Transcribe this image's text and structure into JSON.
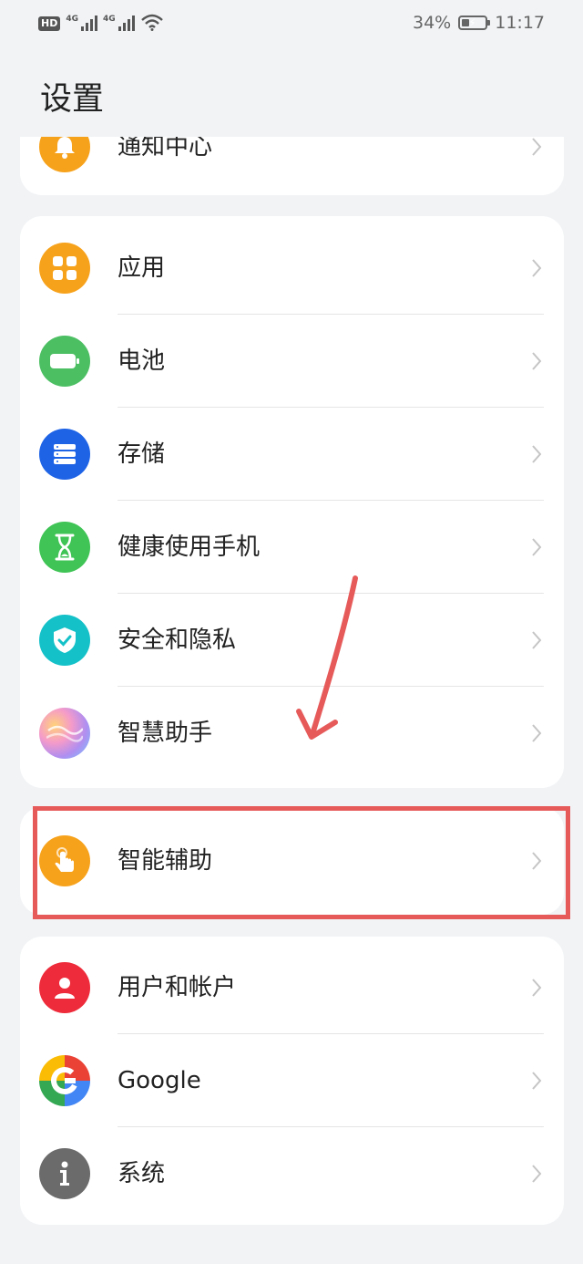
{
  "status_bar": {
    "hd_label": "HD",
    "sim1_label": "4G",
    "sim2_label": "4G",
    "battery_percent": "34%",
    "battery_level": 0.34,
    "time": "11:17"
  },
  "header": {
    "title": "设置"
  },
  "groups": [
    {
      "items": [
        {
          "label": "通知中心",
          "icon": "bell-icon",
          "color": "#f7a21b"
        }
      ]
    },
    {
      "items": [
        {
          "label": "应用",
          "icon": "apps-icon",
          "color": "#f7a21b"
        },
        {
          "label": "电池",
          "icon": "battery-icon",
          "color": "#4cbf63"
        },
        {
          "label": "存储",
          "icon": "storage-icon",
          "color": "#1e63e6"
        },
        {
          "label": "健康使用手机",
          "icon": "hourglass-icon",
          "color": "#3fc455"
        },
        {
          "label": "安全和隐私",
          "icon": "shield-icon",
          "color": "#14c1c8"
        },
        {
          "label": "智慧助手",
          "icon": "assistant-icon",
          "color": "#c9a2ea"
        }
      ]
    },
    {
      "items": [
        {
          "label": "智能辅助",
          "icon": "hand-touch-icon",
          "color": "#f7a21b"
        }
      ]
    },
    {
      "items": [
        {
          "label": "用户和帐户",
          "icon": "user-icon",
          "color": "#ee2b3a"
        },
        {
          "label": "Google",
          "icon": "google-icon",
          "color": "#4285f4"
        },
        {
          "label": "系统",
          "icon": "info-icon",
          "color": "#6b6b6b"
        }
      ]
    }
  ],
  "annotation": {
    "color": "#e65a5a"
  }
}
